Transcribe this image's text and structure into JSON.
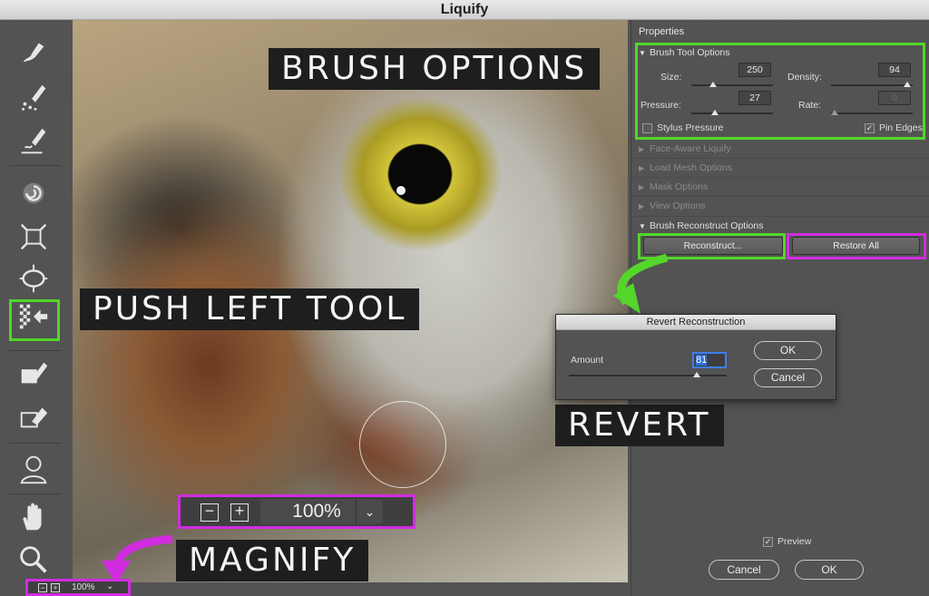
{
  "window": {
    "title": "Liquify"
  },
  "tools": [
    {
      "name": "forward-warp-tool-icon"
    },
    {
      "name": "reconstruct-tool-icon"
    },
    {
      "name": "smooth-tool-icon"
    },
    {
      "name": "twirl-clockwise-tool-icon"
    },
    {
      "name": "pucker-tool-icon"
    },
    {
      "name": "bloat-tool-icon"
    },
    {
      "name": "push-left-tool-icon"
    },
    {
      "name": "freeze-mask-tool-icon"
    },
    {
      "name": "thaw-mask-tool-icon"
    },
    {
      "name": "face-tool-icon"
    },
    {
      "name": "hand-tool-icon"
    },
    {
      "name": "zoom-tool-icon"
    }
  ],
  "properties": {
    "title": "Properties",
    "brush_tool_options": {
      "label": "Brush Tool Options",
      "size_label": "Size:",
      "size": "250",
      "density_label": "Density:",
      "density": "94",
      "pressure_label": "Pressure:",
      "pressure": "27",
      "rate_label": "Rate:",
      "rate": "0",
      "stylus_pressure_label": "Stylus Pressure",
      "stylus_pressure": false,
      "pin_edges_label": "Pin Edges",
      "pin_edges": true
    },
    "sections": {
      "face_aware": "Face-Aware Liquify",
      "load_mesh": "Load Mesh Options",
      "mask": "Mask Options",
      "view": "View Options",
      "brush_reconstruct": "Brush Reconstruct Options"
    },
    "reconstruct_button": "Reconstruct...",
    "restore_all_button": "Restore All",
    "preview_label": "Preview",
    "preview": true,
    "cancel_button": "Cancel",
    "ok_button": "OK"
  },
  "revert_dialog": {
    "title": "Revert Reconstruction",
    "amount_label": "Amount",
    "amount": "81",
    "ok_button": "OK",
    "cancel_button": "Cancel"
  },
  "zoom": {
    "value": "100%",
    "minus": "−",
    "plus": "+",
    "dropdown": "⌄"
  },
  "annotations": {
    "brush_options": "BRUSH OPTIONS",
    "push_left_tool": "PUSH LEFT TOOL",
    "revert": "REVERT",
    "magnify": "MAGNIFY"
  },
  "colors": {
    "highlight_green": "#54d62a",
    "highlight_magenta": "#d12ce0"
  }
}
